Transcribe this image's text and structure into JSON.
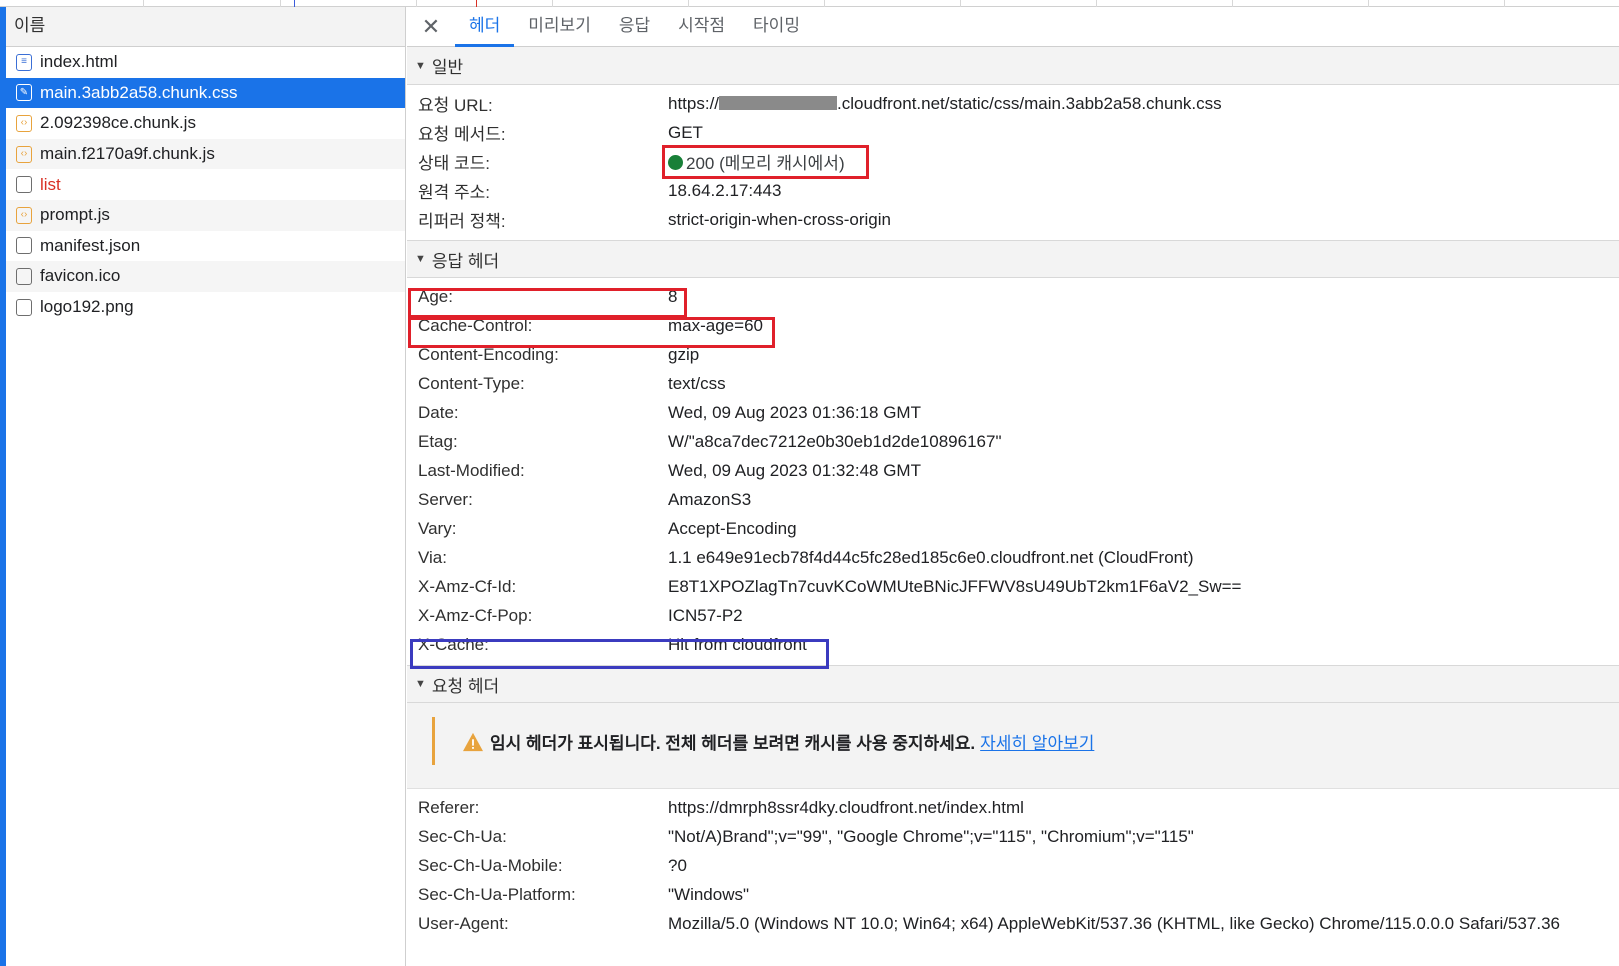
{
  "file_list": {
    "header": "이름",
    "files": [
      {
        "name": "index.html",
        "icon": "document-icon"
      },
      {
        "name": "main.3abb2a58.chunk.css",
        "icon": "stylesheet-icon",
        "selected": true
      },
      {
        "name": "2.092398ce.chunk.js",
        "icon": "script-icon"
      },
      {
        "name": "main.f2170a9f.chunk.js",
        "icon": "script-icon"
      },
      {
        "name": "list",
        "icon": "blank-file-icon",
        "error": true
      },
      {
        "name": "prompt.js",
        "icon": "script-icon"
      },
      {
        "name": "manifest.json",
        "icon": "blank-file-icon"
      },
      {
        "name": "favicon.ico",
        "icon": "blank-file-icon"
      },
      {
        "name": "logo192.png",
        "icon": "blank-file-icon"
      }
    ]
  },
  "tabs": [
    "헤더",
    "미리보기",
    "응답",
    "시작점",
    "타이밍"
  ],
  "general": {
    "title": "일반",
    "url_label": "요청 URL:",
    "url_prefix": "https://",
    "url_suffix": ".cloudfront.net/static/css/main.3abb2a58.chunk.css",
    "method_label": "요청 메서드:",
    "method_value": "GET",
    "status_label": "상태 코드:",
    "status_value": "200 (메모리 캐시에서)",
    "remote_label": "원격 주소:",
    "remote_value": "18.64.2.17:443",
    "referrer_label": "리퍼러 정책:",
    "referrer_value": "strict-origin-when-cross-origin"
  },
  "response_headers": {
    "title": "응답 헤더",
    "rows": [
      {
        "k": "Age:",
        "v": "8"
      },
      {
        "k": "Cache-Control:",
        "v": "max-age=60"
      },
      {
        "k": "Content-Encoding:",
        "v": "gzip"
      },
      {
        "k": "Content-Type:",
        "v": "text/css"
      },
      {
        "k": "Date:",
        "v": "Wed, 09 Aug 2023 01:36:18 GMT"
      },
      {
        "k": "Etag:",
        "v": "W/\"a8ca7dec7212e0b30eb1d2de10896167\""
      },
      {
        "k": "Last-Modified:",
        "v": "Wed, 09 Aug 2023 01:32:48 GMT"
      },
      {
        "k": "Server:",
        "v": "AmazonS3"
      },
      {
        "k": "Vary:",
        "v": "Accept-Encoding"
      },
      {
        "k": "Via:",
        "v": "1.1 e649e91ecb78f4d44c5fc28ed185c6e0.cloudfront.net (CloudFront)"
      },
      {
        "k": "X-Amz-Cf-Id:",
        "v": "E8T1XPOZlagTn7cuvKCoWMUteBNicJFFWV8sU49UbT2km1F6aV2_Sw=="
      },
      {
        "k": "X-Amz-Cf-Pop:",
        "v": "ICN57-P2"
      },
      {
        "k": "X-Cache:",
        "v": "Hit from cloudfront"
      }
    ]
  },
  "request_headers": {
    "title": "요청 헤더",
    "warning_text": "임시 헤더가 표시됩니다. 전체 헤더를 보려면 캐시를 사용 중지하세요.",
    "warning_link": "자세히 알아보기",
    "rows": [
      {
        "k": "Referer:",
        "v": "https://dmrph8ssr4dky.cloudfront.net/index.html"
      },
      {
        "k": "Sec-Ch-Ua:",
        "v": "\"Not/A)Brand\";v=\"99\", \"Google Chrome\";v=\"115\", \"Chromium\";v=\"115\""
      },
      {
        "k": "Sec-Ch-Ua-Mobile:",
        "v": "?0"
      },
      {
        "k": "Sec-Ch-Ua-Platform:",
        "v": "\"Windows\""
      },
      {
        "k": "User-Agent:",
        "v": "Mozilla/5.0 (Windows NT 10.0; Win64; x64) AppleWebKit/537.36 (KHTML, like Gecko) Chrome/115.0.0.0 Safari/537.36"
      }
    ]
  },
  "colors": {
    "accent": "#1a73e8",
    "highlight_red": "#e0202a",
    "highlight_blue": "#3b3bbf",
    "warning": "#e8a33d",
    "status_ok": "#188038",
    "error_text": "#d93025"
  }
}
